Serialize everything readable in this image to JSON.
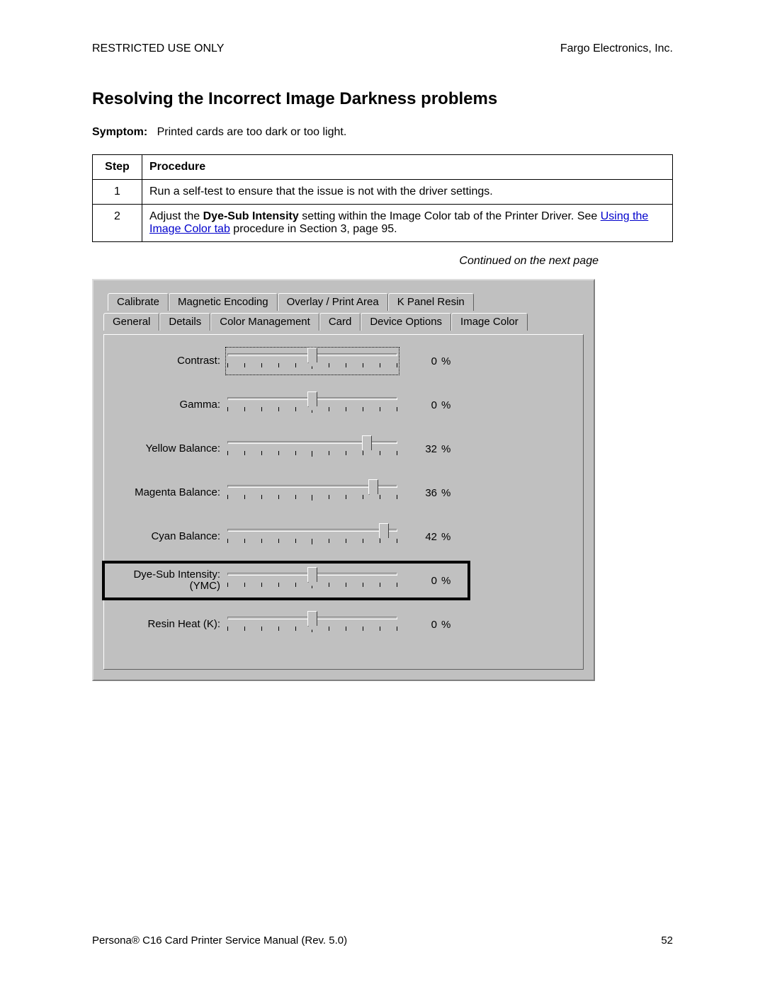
{
  "header": {
    "left": "RESTRICTED USE ONLY",
    "right": "Fargo Electronics, Inc."
  },
  "title": "Resolving the Incorrect Image Darkness problems",
  "symptom": {
    "label": "Symptom:",
    "text": "Printed cards are too dark or too light."
  },
  "table": {
    "head_step": "Step",
    "head_proc": "Procedure",
    "rows": [
      {
        "num": "1",
        "text": "Run a self-test to ensure that the issue is not with the driver settings."
      },
      {
        "num": "2",
        "pre": "Adjust the ",
        "bold": "Dye-Sub Intensity",
        "mid": " setting within the Image Color tab of the Printer Driver. See ",
        "link": "Using the Image Color tab",
        "post": " procedure in Section 3, page 95."
      }
    ]
  },
  "continued": "Continued on the next page",
  "dialog": {
    "tabs_top": [
      "Calibrate",
      "Magnetic Encoding",
      "Overlay / Print Area",
      "K Panel Resin"
    ],
    "tabs_bottom": [
      "General",
      "Details",
      "Color Management",
      "Card",
      "Device Options",
      "Image Color"
    ],
    "active_tab": "Image Color",
    "unit": "%",
    "sliders": [
      {
        "label": "Contrast:",
        "value": "0",
        "pos": 50,
        "focused": true
      },
      {
        "label": "Gamma:",
        "value": "0",
        "pos": 50
      },
      {
        "label": "Yellow Balance:",
        "value": "32",
        "pos": 82
      },
      {
        "label": "Magenta Balance:",
        "value": "36",
        "pos": 86
      },
      {
        "label": "Cyan Balance:",
        "value": "42",
        "pos": 92
      },
      {
        "label": "Dye-Sub Intensity:\n(YMC)",
        "value": "0",
        "pos": 50,
        "highlight": true
      },
      {
        "label": "Resin Heat  (K):",
        "value": "0",
        "pos": 50
      }
    ]
  },
  "footer": {
    "left_pre": "Persona",
    "reg": "®",
    "left_post": " C16 Card Printer Service Manual (Rev. 5.0)",
    "page": "52"
  }
}
